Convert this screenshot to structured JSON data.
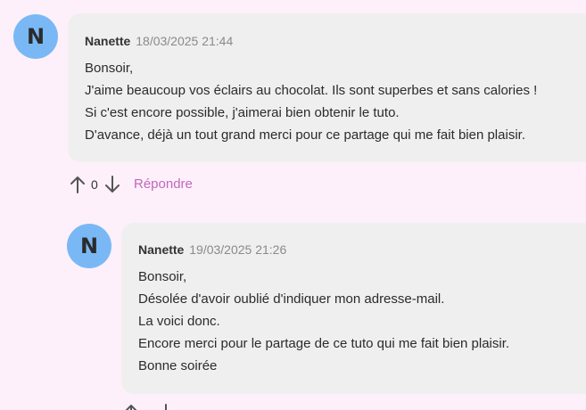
{
  "comments": [
    {
      "avatar_letter": "N",
      "author": "Nanette",
      "date": "18/03/2025 21:44",
      "lines": [
        "Bonsoir,",
        "J'aime beaucoup vos éclairs au chocolat. Ils sont superbes et sans calories !",
        "Si c'est encore possible, j'aimerai bien obtenir le tuto.",
        "D'avance, déjà un tout grand merci pour ce partage qui me fait bien plaisir."
      ],
      "vote_count": "0",
      "reply_label": "Répondre",
      "upvote_icon": "arrow-up-icon",
      "downvote_icon": "arrow-down-icon"
    },
    {
      "avatar_letter": "N",
      "author": "Nanette",
      "date": "19/03/2025 21:26",
      "lines": [
        "Bonsoir,",
        "Désolée d'avoir oublié d'indiquer mon adresse-mail.",
        "La voici donc.",
        "Encore merci pour le partage de ce tuto qui me fait bien plaisir.",
        "Bonne soirée"
      ],
      "upvote_icon": "arrow-up-icon",
      "downvote_icon": "arrow-down-icon"
    }
  ],
  "colors": {
    "background": "#fdf0fa",
    "bubble": "#efefef",
    "avatar": "#7ab8f5",
    "reply_link": "#c266c2",
    "date_text": "#8a8a8a"
  }
}
